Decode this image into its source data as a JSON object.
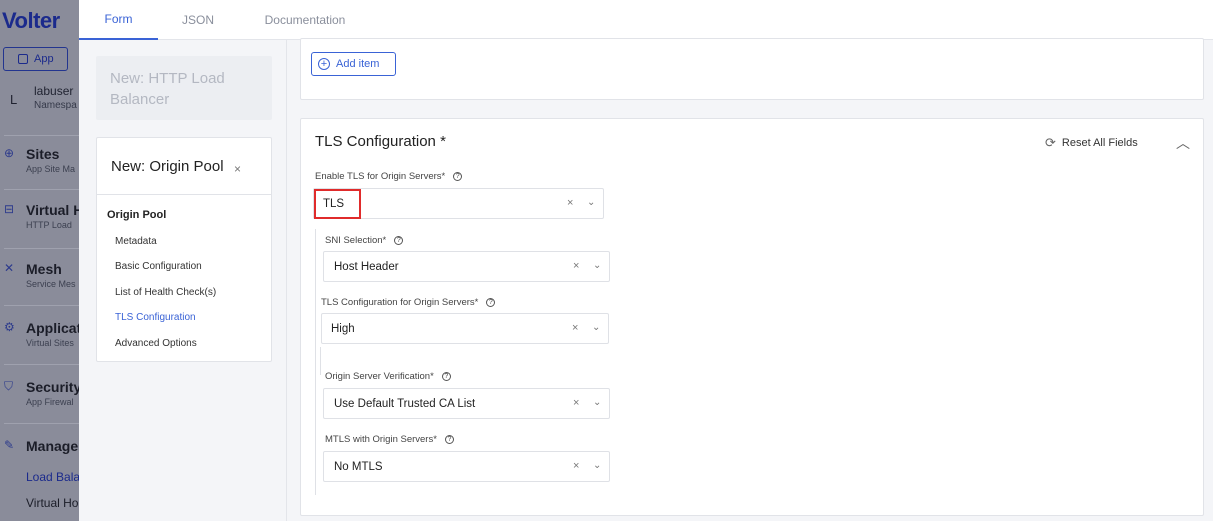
{
  "bg_nav": {
    "logo": "Volter",
    "app_button": "App",
    "user": {
      "avatar": "L",
      "name": "labuser",
      "namespace": "Namespa"
    },
    "sections": [
      {
        "title": "Sites",
        "sub": "App Site Ma"
      },
      {
        "title": "Virtual H",
        "sub": "HTTP Load"
      },
      {
        "title": "Mesh",
        "sub": "Service Mes"
      },
      {
        "title": "Applicati",
        "sub": "Virtual Sites"
      },
      {
        "title": "Security",
        "sub": "App Firewal"
      },
      {
        "title": "Manage",
        "sub": ""
      }
    ],
    "links": [
      "Load Bala",
      "Virtual Ho"
    ]
  },
  "tabs": [
    "Form",
    "JSON",
    "Documentation"
  ],
  "left": {
    "crumb": "New: HTTP Load Balancer",
    "pool_title": "New: Origin Pool",
    "pool_close": "×",
    "pool_head": "Origin Pool",
    "pool_items": [
      "Metadata",
      "Basic Configuration",
      "List of Health Check(s)",
      "TLS Configuration",
      "Advanced Options"
    ]
  },
  "main": {
    "add_item": "Add item",
    "tls_section": {
      "title": "TLS Configuration *",
      "reset": "Reset All Fields",
      "enable_tls_label": "Enable TLS for Origin Servers*",
      "enable_tls_value": "TLS",
      "fields": [
        {
          "label": "SNI Selection*",
          "value": "Host Header"
        },
        {
          "label": "TLS Configuration for Origin Servers*",
          "value": "High"
        },
        {
          "label": "Origin Server Verification*",
          "value": "Use Default Trusted CA List"
        },
        {
          "label": "MTLS with Origin Servers*",
          "value": "No MTLS"
        }
      ]
    }
  },
  "icons": {
    "help": "?",
    "clear": "×",
    "chevron_down": "⌄",
    "chevron_up": "︿",
    "refresh": "⟳",
    "plus": "+"
  },
  "colors": {
    "accent": "#3a63d6",
    "highlight": "#e02b2b",
    "nav_dim": "#8a8c9a"
  }
}
